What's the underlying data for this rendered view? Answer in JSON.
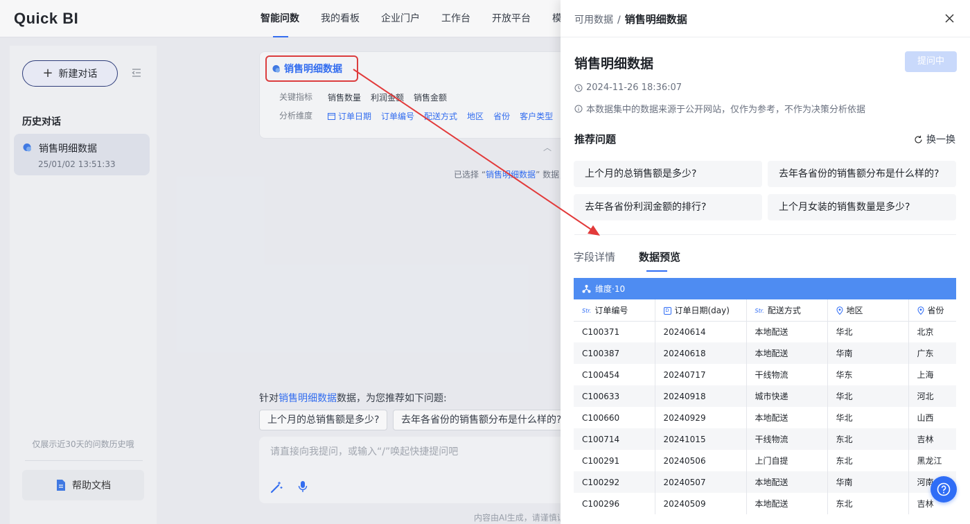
{
  "app": {
    "logo": "Quick BI"
  },
  "nav": {
    "items": [
      {
        "label": "智能问数",
        "active": true
      },
      {
        "label": "我的看板"
      },
      {
        "label": "企业门户"
      },
      {
        "label": "工作台"
      },
      {
        "label": "开放平台"
      },
      {
        "label": "模板"
      }
    ]
  },
  "sidebar": {
    "new_chat": "新建对话",
    "history_title": "历史对话",
    "history": [
      {
        "title": "销售明细数据",
        "time": "25/01/02 13:51:33"
      }
    ],
    "note": "仅展示近30天的问数历史哦",
    "help": "帮助文档"
  },
  "main": {
    "dataset": {
      "name": "销售明细数据",
      "metrics_label": "关键指标",
      "metrics": [
        "销售数量",
        "利润金额",
        "销售金额"
      ],
      "dims_label": "分析维度",
      "dims": [
        "订单日期",
        "订单编号",
        "配送方式",
        "地区",
        "省份",
        "客户类型"
      ]
    },
    "selected_note": {
      "prefix": "已选择 “",
      "name": "销售明细数据",
      "suffix": "” 数据，"
    },
    "recommend": {
      "prefix": "针对",
      "name": "销售明细数据",
      "suffix": "数据，为您推荐如下问题:",
      "chips": [
        "上个月的总销售额是多少?",
        "去年各省份的销售额分布是什么样的?"
      ]
    },
    "input_placeholder": "请直接向我提问，或输入“/”唤起快捷提问吧",
    "footer": "内容由AI生成，请谨慎识"
  },
  "drawer": {
    "breadcrumb_root": "可用数据",
    "breadcrumb_sep": "/",
    "breadcrumb_current": "销售明细数据",
    "title": "销售明细数据",
    "ask_button": "提问中",
    "timestamp": "2024-11-26 18:36:07",
    "disclaimer": "本数据集中的数据来源于公开网站，仅作为参考，不作为决策分析依据",
    "rec_title": "推荐问题",
    "refresh": "换一换",
    "questions": [
      "上个月的总销售额是多少?",
      "去年各省份的销售额分布是什么样的?",
      "去年各省份利润金额的排行?",
      "上个月女装的销售数量是多少?"
    ],
    "tabs": [
      {
        "label": "字段详情"
      },
      {
        "label": "数据预览",
        "active": true
      }
    ],
    "grid": {
      "group_label": "维度·10",
      "columns": [
        {
          "label": "订单编号",
          "type": "Str"
        },
        {
          "label": "订单日期(day)",
          "type": "D"
        },
        {
          "label": "配送方式",
          "type": "Str"
        },
        {
          "label": "地区",
          "type": "geo"
        },
        {
          "label": "省份",
          "type": "geo"
        }
      ],
      "rows": [
        [
          "C100371",
          "20240614",
          "本地配送",
          "华北",
          "北京"
        ],
        [
          "C100387",
          "20240618",
          "本地配送",
          "华南",
          "广东"
        ],
        [
          "C100454",
          "20240717",
          "干线物流",
          "华东",
          "上海"
        ],
        [
          "C100633",
          "20240918",
          "城市快递",
          "华北",
          "河北"
        ],
        [
          "C100660",
          "20240929",
          "本地配送",
          "华北",
          "山西"
        ],
        [
          "C100714",
          "20241015",
          "干线物流",
          "东北",
          "吉林"
        ],
        [
          "C100291",
          "20240506",
          "上门自提",
          "东北",
          "黑龙江"
        ],
        [
          "C100292",
          "20240507",
          "本地配送",
          "华南",
          "河南"
        ],
        [
          "C100296",
          "20240509",
          "本地配送",
          "东北",
          "吉林"
        ]
      ]
    }
  },
  "colors": {
    "accent": "#2f6df6",
    "annotation_red": "#e23a3a",
    "grid_header": "#4e8cf2"
  }
}
